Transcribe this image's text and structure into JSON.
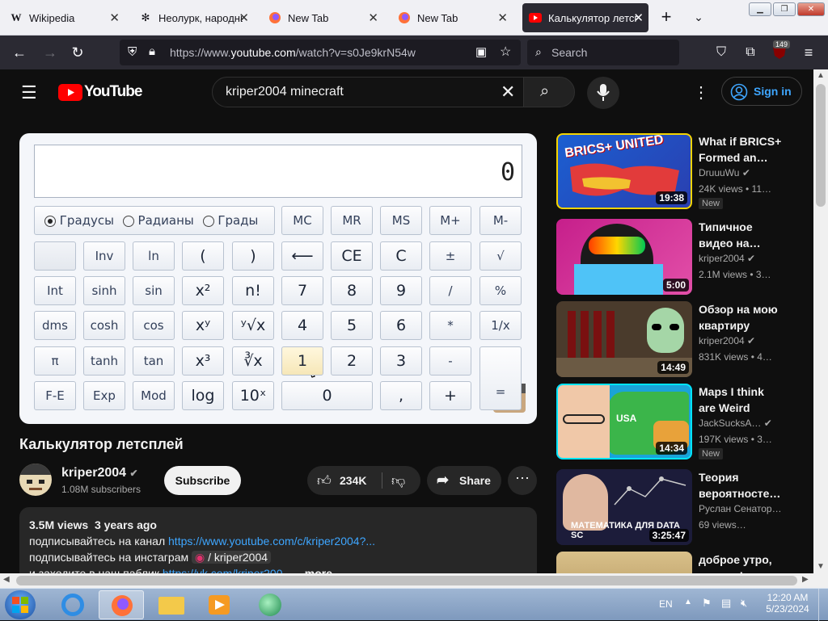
{
  "browser": {
    "tabs": [
      {
        "title": "Wikipedia",
        "fav": "W"
      },
      {
        "title": "Неолурк, народны",
        "fav": "⚙"
      },
      {
        "title": "New Tab",
        "fav": "ff"
      },
      {
        "title": "New Tab",
        "fav": "ff"
      },
      {
        "title": "Калькулятор летспл",
        "fav": "yt"
      }
    ],
    "url_prefix": "https://www.",
    "url_domain": "youtube.com",
    "url_path": "/watch?v=s0Je9krN54w",
    "search_placeholder": "Search",
    "badge_count": "149"
  },
  "youtube": {
    "logo_text": "YouTube",
    "search_query": "kriper2004 minecraft",
    "signin_label": "Sign in"
  },
  "calculator": {
    "display_value": "0",
    "radio_options": [
      "Градусы",
      "Радианы",
      "Грады"
    ],
    "memory_buttons": [
      "MC",
      "MR",
      "MS",
      "M+",
      "M-"
    ],
    "rows": [
      [
        "",
        "Inv",
        "ln",
        "(",
        ")",
        "⟵",
        "CE",
        "C",
        "±",
        "√"
      ],
      [
        "Int",
        "sinh",
        "sin",
        "x²",
        "n!",
        "7",
        "8",
        "9",
        "/",
        "%"
      ],
      [
        "dms",
        "cosh",
        "cos",
        "xʸ",
        "ʸ√x",
        "4",
        "5",
        "6",
        "*",
        "1/x"
      ],
      [
        "π",
        "tanh",
        "tan",
        "x³",
        "∛x",
        "1",
        "2",
        "3",
        "-",
        "="
      ],
      [
        "F-E",
        "Exp",
        "Mod",
        "log",
        "10ˣ",
        "0",
        ",",
        "+"
      ]
    ]
  },
  "video": {
    "title": "Калькулятор летсплей",
    "channel": "kriper2004",
    "subscribers": "1.08M subscribers",
    "subscribe_label": "Subscribe",
    "likes": "234K",
    "share_label": "Share",
    "views": "3.5M views",
    "date": "3 years ago",
    "desc_line1": "подписывайтесь на канал ",
    "desc_link1": "https://www.youtube.com/c/kriper2004?...",
    "desc_line2": "подписывайтесь на инстаграм",
    "desc_insta": " / kriper2004",
    "desc_line3": "и заходите в наш паблик ",
    "desc_link3": "https://vk.com/kriper200...",
    "more_label": "...more"
  },
  "recommendations": [
    {
      "title": "What if BRICS+ Formed an…",
      "channel": "DruuuWu",
      "meta": "24K views  • 11…",
      "duration": "19:38",
      "new": "New",
      "thumb_text": "BRICS+ UNITED"
    },
    {
      "title": "Типичное видео на…",
      "channel": "kriper2004",
      "meta": "2.1M views  • 3…",
      "duration": "5:00",
      "new": "",
      "thumb_text": ""
    },
    {
      "title": "Обзор на мою квартиру",
      "channel": "kriper2004",
      "meta": "831K views  • 4…",
      "duration": "14:49",
      "new": "",
      "thumb_text": ""
    },
    {
      "title": "Maps I think are Weird",
      "channel": "JackSucksA…",
      "meta": "197K views  • 3…",
      "duration": "14:34",
      "new": "New",
      "thumb_text": "USA"
    },
    {
      "title": "Теория вероятносте…",
      "channel": "Руслан Сенатор…",
      "meta": "69 views…",
      "duration": "3:25:47",
      "new": "",
      "thumb_text": "МАТЕМАТИКА ДЛЯ DATA SC"
    },
    {
      "title": "доброе утро, малыш!",
      "channel": "",
      "meta": "",
      "duration": "",
      "new": "",
      "thumb_text": ""
    }
  ],
  "taskbar": {
    "lang": "EN",
    "time": "12:20 AM",
    "date": "5/23/2024"
  }
}
